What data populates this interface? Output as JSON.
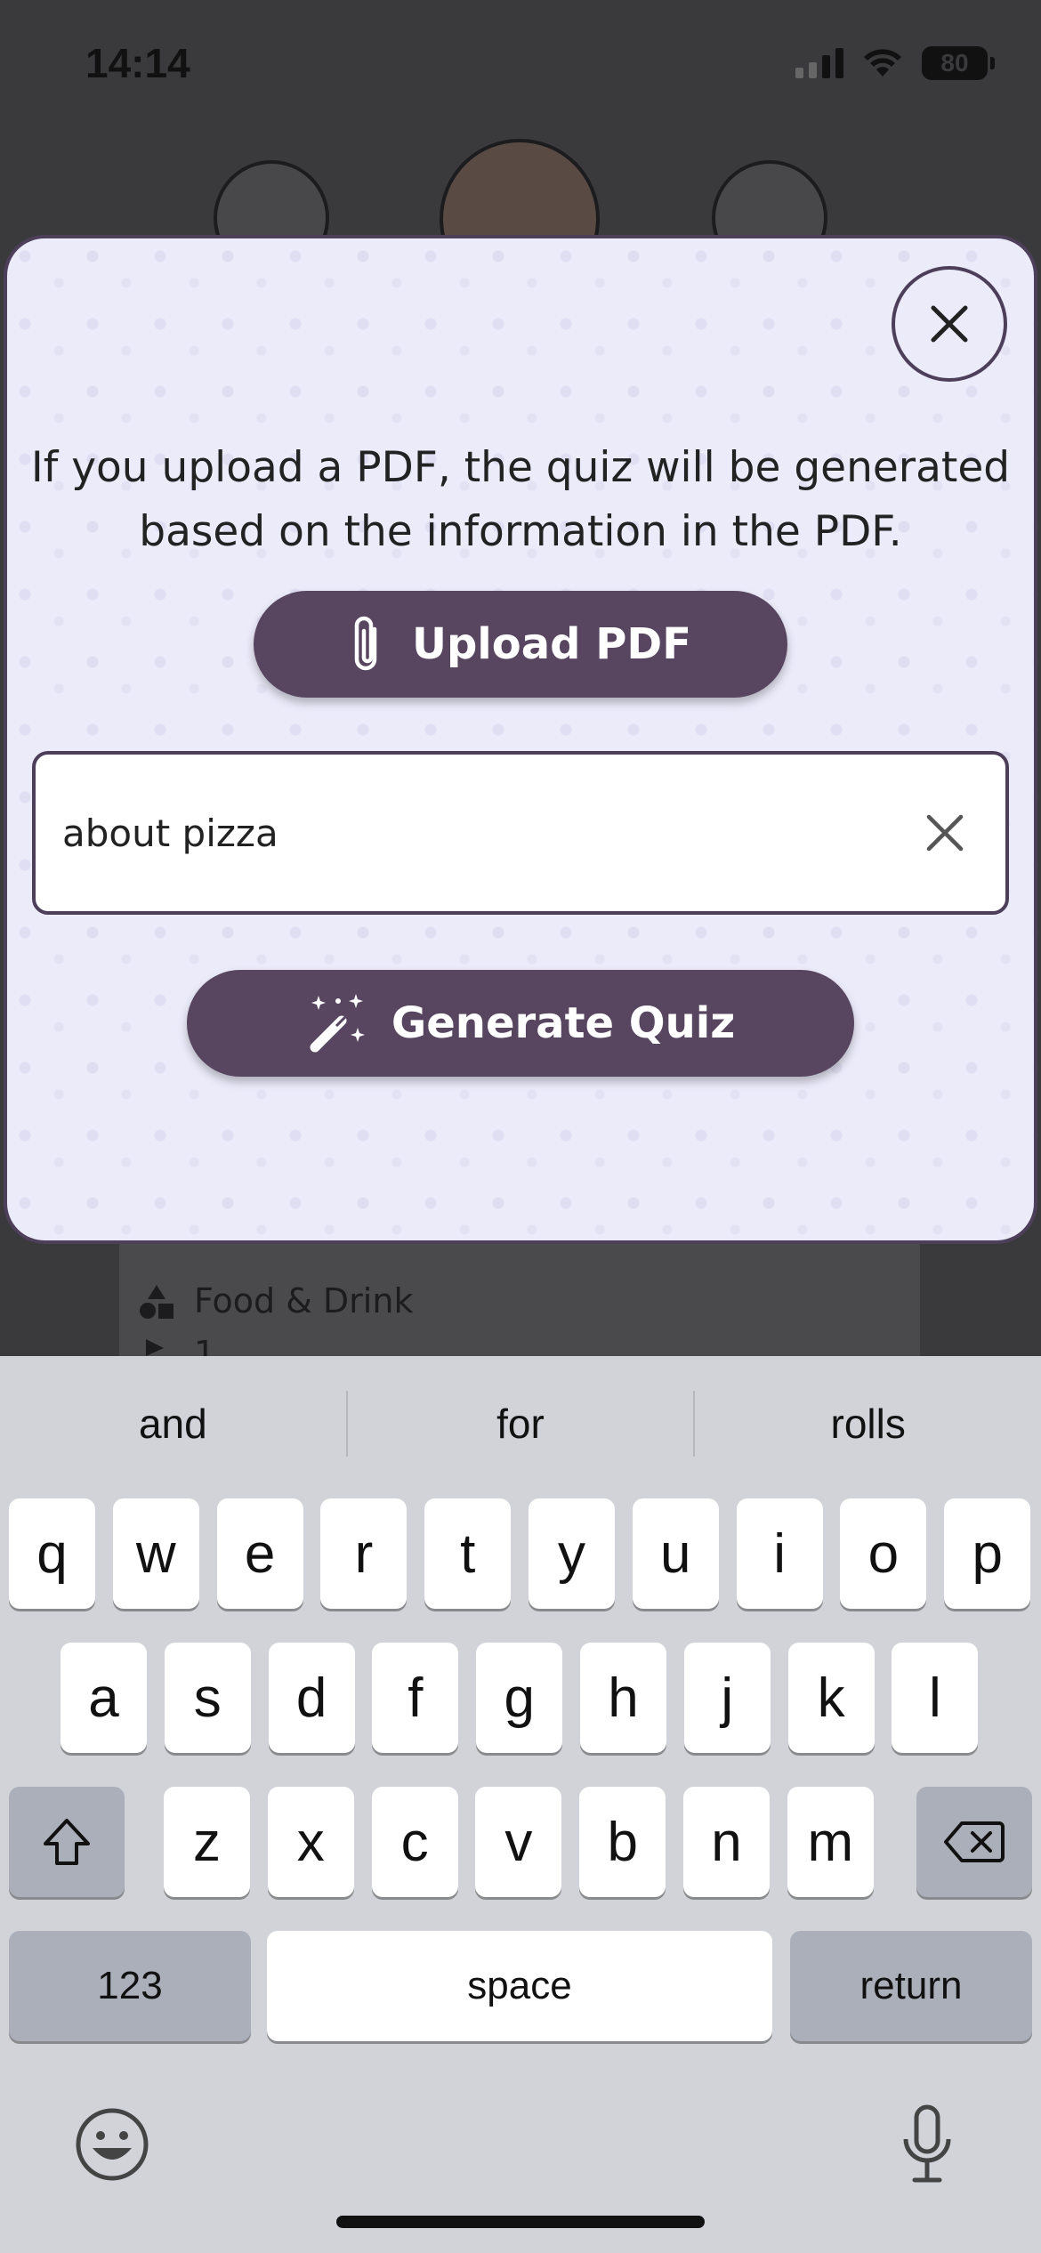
{
  "status_bar": {
    "time": "14:14",
    "battery": "80"
  },
  "background": {
    "card_category": "Food & Drink",
    "card_meta": "1"
  },
  "modal": {
    "info_text": "If you upload a PDF, the quiz will be generated based on the information in the PDF.",
    "upload_label": "Upload PDF",
    "input_value": "about pizza",
    "generate_label": "Generate Quiz"
  },
  "keyboard": {
    "suggestions": [
      "and",
      "for",
      "rolls"
    ],
    "row1": [
      "q",
      "w",
      "e",
      "r",
      "t",
      "y",
      "u",
      "i",
      "o",
      "p"
    ],
    "row2": [
      "a",
      "s",
      "d",
      "f",
      "g",
      "h",
      "j",
      "k",
      "l"
    ],
    "row3": [
      "z",
      "x",
      "c",
      "v",
      "b",
      "n",
      "m"
    ],
    "numbers_label": "123",
    "space_label": "space",
    "return_label": "return"
  },
  "colors": {
    "accent": "#584661",
    "modal_bg": "#ebebfa",
    "keyboard_bg": "#d1d3d9"
  }
}
